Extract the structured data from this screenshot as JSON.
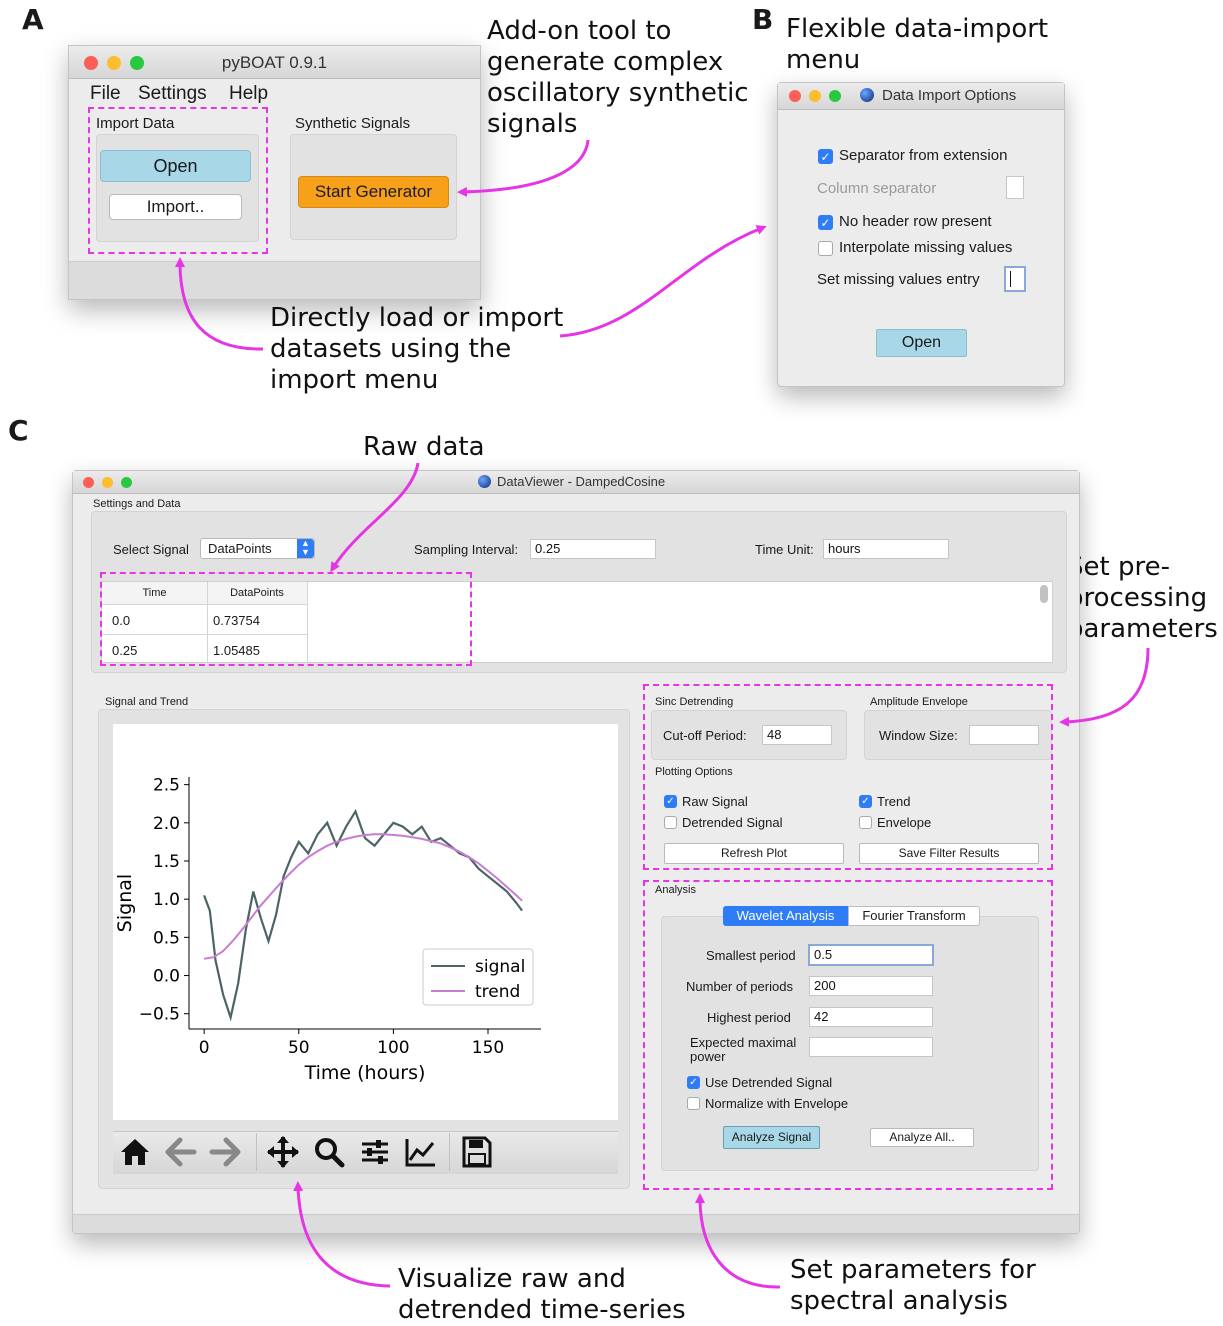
{
  "panels": {
    "a": "A",
    "b": "B",
    "c": "C"
  },
  "colors": {
    "highlight": "#e535e5",
    "signal": "#4d6466",
    "trend": "#c77dd1",
    "orange": "#f7a11a",
    "open_blue": "#a8d8e8"
  },
  "annotations": {
    "addon": "Add-on tool to\ngenerate complex\noscillatory synthetic\nsignals",
    "flexible": "Flexible data-import\nmenu",
    "directly": "Directly load or import\ndatasets using the\nimport menu",
    "raw_data": "Raw data",
    "preprocessing": "Set pre-\nprocessing\nparameters",
    "visualize": "Visualize raw and\ndetrended time-series",
    "spectral": "Set parameters for\nspectral analysis"
  },
  "pyboat": {
    "title": "pyBOAT 0.9.1",
    "menu": [
      "File",
      "Settings",
      "Help"
    ],
    "import_group": "Import Data",
    "open_label": "Open",
    "import_label": "Import..",
    "synth_group": "Synthetic Signals",
    "generator_label": "Start Generator"
  },
  "import_dialog": {
    "title": "Data Import Options",
    "sep_from_ext": "Separator from extension",
    "column_sep": "Column separator",
    "no_header": "No header row present",
    "interpolate": "Interpolate missing values",
    "missing_entry": "Set missing values entry",
    "open_label": "Open"
  },
  "dataviewer": {
    "title": "DataViewer - DampedCosine",
    "settings_group": "Settings and Data",
    "select_signal_label": "Select Signal",
    "select_signal_value": "DataPoints",
    "sampling_label": "Sampling Interval:",
    "sampling_value": "0.25",
    "time_unit_label": "Time Unit:",
    "time_unit_value": "hours",
    "table": {
      "headers": [
        "Time",
        "DataPoints"
      ],
      "rows": [
        [
          "0.0",
          "0.73754"
        ],
        [
          "0.25",
          "1.05485"
        ]
      ]
    },
    "signal_trend_group": "Signal and Trend",
    "sinc_group": "Sinc Detrending",
    "cutoff_label": "Cut-off Period:",
    "cutoff_value": "48",
    "amp_group": "Amplitude Envelope",
    "window_label": "Window Size:",
    "window_value": "",
    "plotting_group": "Plotting Options",
    "raw_signal": "Raw Signal",
    "trend": "Trend",
    "detrended_signal": "Detrended Signal",
    "envelope": "Envelope",
    "refresh_plot": "Refresh Plot",
    "save_filter": "Save Filter Results",
    "analysis_group": "Analysis",
    "tab_wavelet": "Wavelet Analysis",
    "tab_fourier": "Fourier Transform",
    "smallest_label": "Smallest period",
    "smallest_value": "0.5",
    "number_label": "Number of periods",
    "number_value": "200",
    "highest_label": "Highest  period",
    "highest_value": "42",
    "expected_label": "Expected maximal power",
    "expected_value": "",
    "use_detrended": "Use Detrended Signal",
    "normalize_env": "Normalize with Envelope",
    "analyze_signal": "Analyze Signal",
    "analyze_all": "Analyze All..",
    "toolbar_icons": [
      "home-icon",
      "back-arrow-icon",
      "forward-arrow-icon",
      "pan-icon",
      "zoom-icon",
      "configure-subplots-icon",
      "edit-axis-icon",
      "save-icon"
    ]
  },
  "chart_data": {
    "type": "line",
    "xlabel": "Time (hours)",
    "ylabel": "Signal",
    "xlim": [
      -8,
      178
    ],
    "ylim": [
      -0.7,
      2.6
    ],
    "xticks": [
      0,
      50,
      100,
      150
    ],
    "yticks": [
      -0.5,
      0.0,
      0.5,
      1.0,
      1.5,
      2.0,
      2.5
    ],
    "ytick_labels": [
      "−0.5",
      "0.0",
      "0.5",
      "1.0",
      "1.5",
      "2.0",
      "2.5"
    ],
    "legend_placement": "lower-right",
    "grid": false,
    "series": [
      {
        "name": "signal",
        "color": "#4d6466",
        "x": [
          0,
          3,
          6,
          10,
          14,
          18,
          22,
          26,
          30,
          34,
          38,
          42,
          46,
          50,
          55,
          60,
          65,
          70,
          75,
          80,
          85,
          90,
          95,
          100,
          105,
          110,
          115,
          120,
          125,
          130,
          135,
          140,
          145,
          150,
          155,
          160,
          165,
          168
        ],
        "y": [
          1.05,
          0.85,
          0.2,
          -0.25,
          -0.55,
          -0.1,
          0.6,
          1.1,
          0.75,
          0.45,
          0.8,
          1.3,
          1.55,
          1.75,
          1.6,
          1.85,
          2.0,
          1.7,
          1.95,
          2.15,
          1.8,
          1.7,
          1.85,
          2.0,
          1.95,
          1.85,
          1.95,
          1.75,
          1.8,
          1.7,
          1.6,
          1.55,
          1.4,
          1.3,
          1.2,
          1.1,
          0.95,
          0.85
        ]
      },
      {
        "name": "trend",
        "color": "#c77dd1",
        "x": [
          0,
          5,
          10,
          15,
          20,
          25,
          30,
          35,
          40,
          45,
          50,
          55,
          60,
          65,
          70,
          75,
          80,
          85,
          90,
          95,
          100,
          105,
          110,
          115,
          120,
          125,
          130,
          135,
          140,
          145,
          150,
          155,
          160,
          165,
          168
        ],
        "y": [
          0.22,
          0.24,
          0.32,
          0.45,
          0.6,
          0.76,
          0.92,
          1.06,
          1.2,
          1.33,
          1.45,
          1.55,
          1.63,
          1.7,
          1.75,
          1.79,
          1.82,
          1.84,
          1.85,
          1.85,
          1.84,
          1.83,
          1.81,
          1.79,
          1.76,
          1.73,
          1.68,
          1.62,
          1.55,
          1.47,
          1.37,
          1.27,
          1.16,
          1.05,
          0.98
        ]
      }
    ]
  }
}
